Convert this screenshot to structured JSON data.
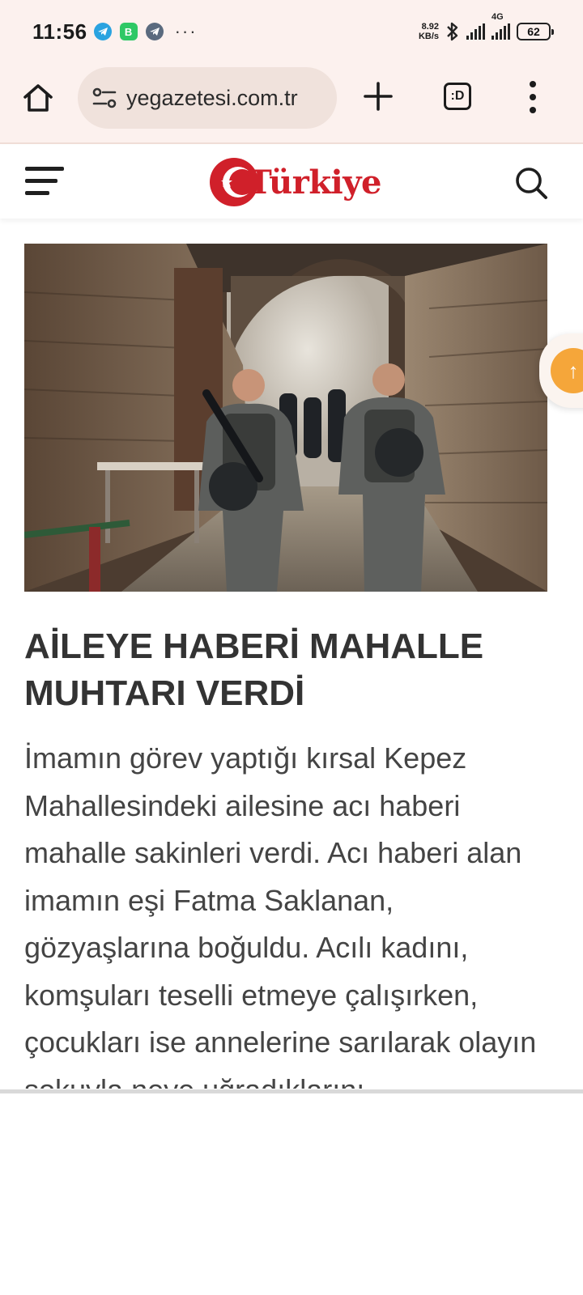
{
  "status_bar": {
    "time": "11:56",
    "notification_icons": [
      "telegram-icon",
      "whatsapp-business-icon",
      "telegram-icon"
    ],
    "more": "···",
    "net_speed_value": "8.92",
    "net_speed_unit": "KB/s",
    "network_type": "4G",
    "battery": "62"
  },
  "browser": {
    "url": "yegazetesi.com.tr",
    "tabs_label": ":D"
  },
  "site": {
    "logo_text": "Türkiye"
  },
  "article": {
    "headline": "AİLEYE HABERİ MAHALLE MUHTARI VERDİ",
    "body": "İmamın görev yaptığı kırsal Kepez Mahallesindeki ailesine acı haberi mahalle sakinleri verdi. Acı haberi alan imamın eşi Fatma Saklanan, gözyaşlarına boğuldu. Acılı kadını, komşuları teselli etmeye çalışırken, çocukları ise annelerine sarılarak olayın şokuyla neye uğradıklarını"
  },
  "colors": {
    "browser_bg": "#fcf1ee",
    "url_pill_bg": "#f0e2dc",
    "brand_red": "#d0202a",
    "headline": "#333333",
    "body_text": "#444444",
    "float_badge": "#f5a63a"
  }
}
